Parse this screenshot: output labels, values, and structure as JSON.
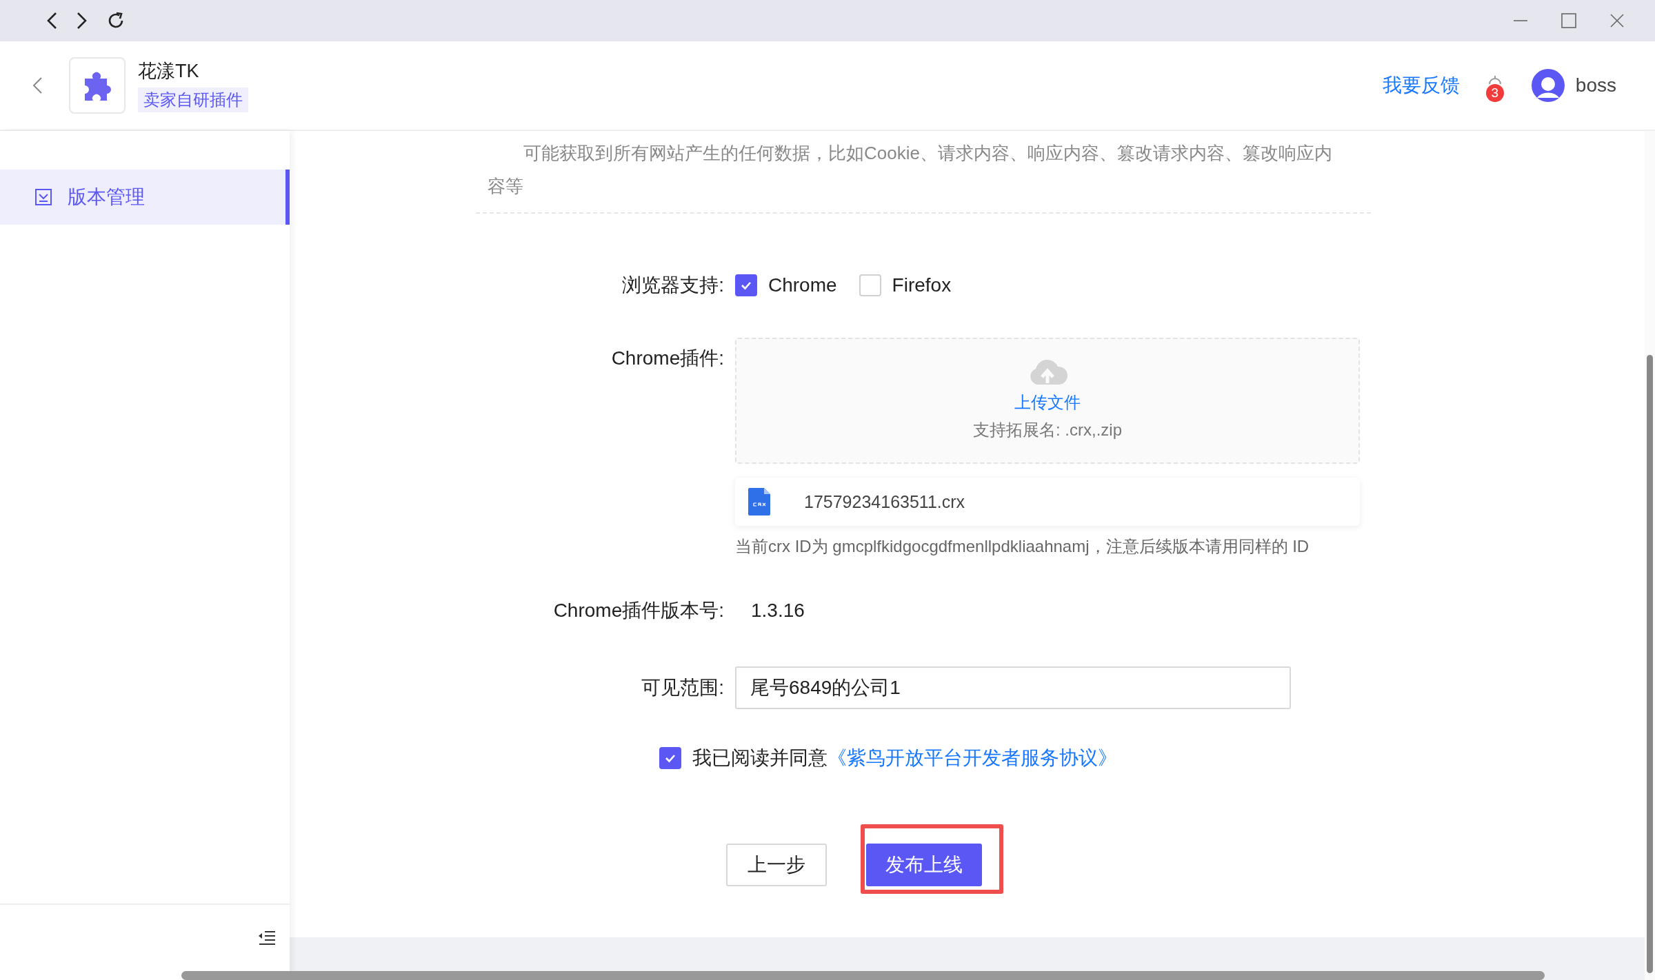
{
  "header": {
    "app_name": "花漾TK",
    "app_tag": "卖家自研插件",
    "feedback_link": "我要反馈",
    "notification_count": "3",
    "user_name": "boss"
  },
  "sidebar": {
    "items": [
      {
        "label": "版本管理",
        "selected": true
      }
    ]
  },
  "notice": {
    "text": "可能获取到所有网站产生的任何数据，比如Cookie、请求内容、响应内容、篡改请求内容、篡改响应内容等"
  },
  "form": {
    "browser_support": {
      "label": "浏览器支持:",
      "options": [
        {
          "label": "Chrome",
          "checked": true
        },
        {
          "label": "Firefox",
          "checked": false
        }
      ]
    },
    "plugin": {
      "label": "Chrome插件:",
      "upload_text": "上传文件",
      "upload_hint": "支持拓展名: .crx,.zip",
      "file_name": "17579234163511.crx",
      "id_hint": "当前crx ID为 gmcplfkidgocgdfmenllpdkliaahnamj，注意后续版本请用同样的 ID"
    },
    "version": {
      "label": "Chrome插件版本号:",
      "value": "1.3.16"
    },
    "visibility": {
      "label": "可见范围:",
      "value": "尾号6849的公司1"
    },
    "agreement": {
      "checked": true,
      "text": "我已阅读并同意",
      "link": "《紫鸟开放平台开发者服务协议》"
    },
    "buttons": [
      {
        "label": "上一步",
        "kind": "default",
        "highlighted": false
      },
      {
        "label": "发布上线",
        "kind": "primary",
        "highlighted": true
      }
    ]
  }
}
